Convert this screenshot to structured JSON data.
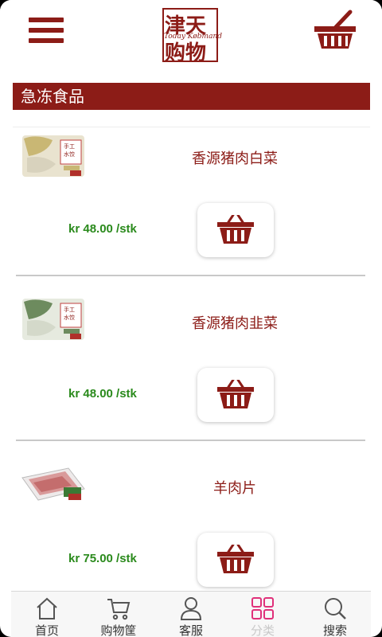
{
  "header": {
    "logo": {
      "line1": "津天",
      "line2": "购物",
      "script": "Today Købmand"
    },
    "menu_icon": "hamburger-menu-icon",
    "cart_icon": "shopping-basket-icon"
  },
  "category": {
    "title": "急冻食品"
  },
  "products": [
    {
      "name": "香源猪肉白菜",
      "price": "kr 48.00 /stk",
      "icon": "dumpling-package-image"
    },
    {
      "name": "香源猪肉韭菜",
      "price": "kr 48.00 /stk",
      "icon": "dumpling-package-image"
    },
    {
      "name": "羊肉片",
      "price": "kr 75.00 /stk",
      "icon": "lamb-slices-package-image"
    }
  ],
  "bottom_nav": {
    "items": [
      {
        "label": "首页",
        "icon": "home-icon"
      },
      {
        "label": "购物筐",
        "icon": "cart-icon"
      },
      {
        "label": "客服",
        "icon": "user-icon"
      },
      {
        "label": "分类",
        "icon": "grid-icon",
        "active": true
      },
      {
        "label": "搜索",
        "icon": "search-icon"
      }
    ]
  },
  "colors": {
    "brand": "#8c1c17",
    "price": "#2a8a1c",
    "nav_active": "#e0307a"
  }
}
